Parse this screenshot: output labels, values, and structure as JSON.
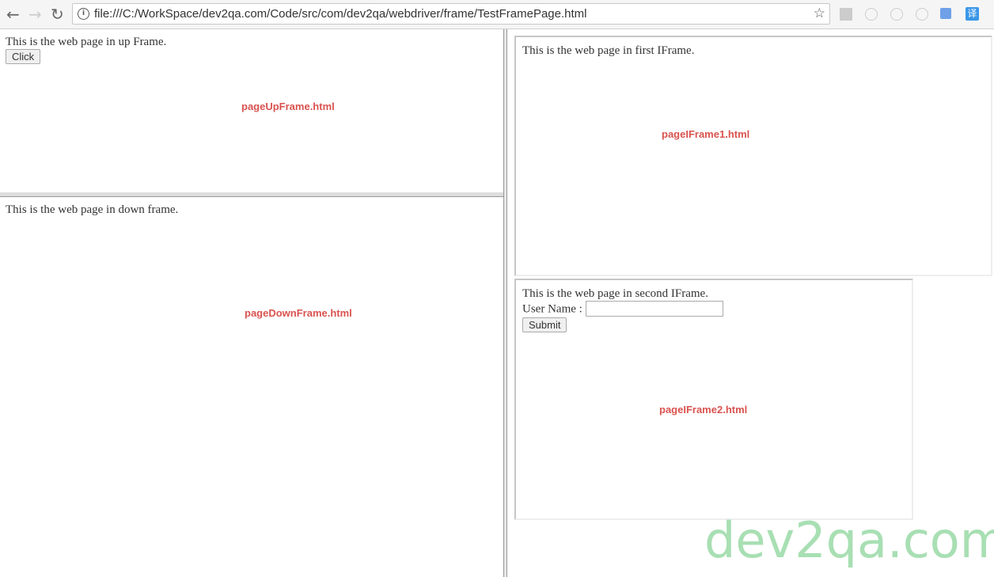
{
  "browser": {
    "url": "file:///C:/WorkSpace/dev2qa.com/Code/src/com/dev2qa/webdriver/frame/TestFramePage.html",
    "icons": [
      "back-icon",
      "forward-icon",
      "reload-icon",
      "info-icon",
      "star-icon",
      "pdf-extension-icon",
      "extension-icon",
      "extension-icon",
      "extension-icon",
      "google-translate-icon",
      "translate-icon"
    ]
  },
  "up_frame": {
    "text": "This is the web page in up Frame.",
    "button": "Click",
    "label": "pageUpFrame.html"
  },
  "down_frame": {
    "text": "This is the web page in down frame.",
    "label": "pageDownFrame.html"
  },
  "iframe1": {
    "text": "This is the web page in first IFrame.",
    "label": "pageIFrame1.html"
  },
  "iframe2": {
    "text": "This is the web page in second IFrame.",
    "user_label": "User Name :",
    "user_value": "",
    "submit": "Submit",
    "label": "pageIFrame2.html"
  },
  "watermark": "dev2qa.com",
  "colors": {
    "label": "#d9534f",
    "watermark": "#a8dfb3"
  }
}
